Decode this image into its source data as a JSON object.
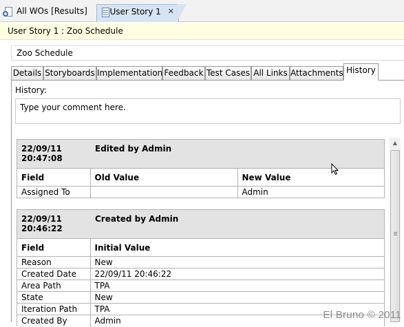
{
  "doc_tabs": [
    {
      "label": "All WOs [Results]"
    },
    {
      "label": "User Story 1",
      "close": "✕"
    }
  ],
  "title_strip": "User Story 1 : Zoo Schedule",
  "title_field": "Zoo Schedule",
  "section_tabs": [
    {
      "label": "Details"
    },
    {
      "label": "Storyboards"
    },
    {
      "label": "Implementation"
    },
    {
      "label": "Feedback"
    },
    {
      "label": "Test Cases"
    },
    {
      "label": "All Links"
    },
    {
      "label": "Attachments"
    },
    {
      "label": "History",
      "active": true
    }
  ],
  "history": {
    "label": "History:",
    "comment_placeholder": "Type your comment here."
  },
  "entries": [
    {
      "date": "22/09/11",
      "time": "20:47:08",
      "action": "Edited by Admin",
      "headers": [
        "Field",
        "Old Value",
        "New Value"
      ],
      "rows": [
        [
          "Assigned To",
          "",
          "Admin"
        ]
      ]
    },
    {
      "date": "22/09/11",
      "time": "20:46:22",
      "action": "Created by Admin",
      "headers": [
        "Field",
        "Initial Value"
      ],
      "rows": [
        [
          "Reason",
          "New"
        ],
        [
          "Created Date",
          "22/09/11 20:46:22"
        ],
        [
          "Area Path",
          "TPA"
        ],
        [
          "State",
          "New"
        ],
        [
          "Iteration Path",
          "TPA"
        ],
        [
          "Created By",
          "Admin"
        ]
      ]
    }
  ],
  "watermark": "El Bruno © 2011",
  "icons": {
    "query": "query-results-icon",
    "story": "work-item-icon",
    "close": "close-icon"
  }
}
